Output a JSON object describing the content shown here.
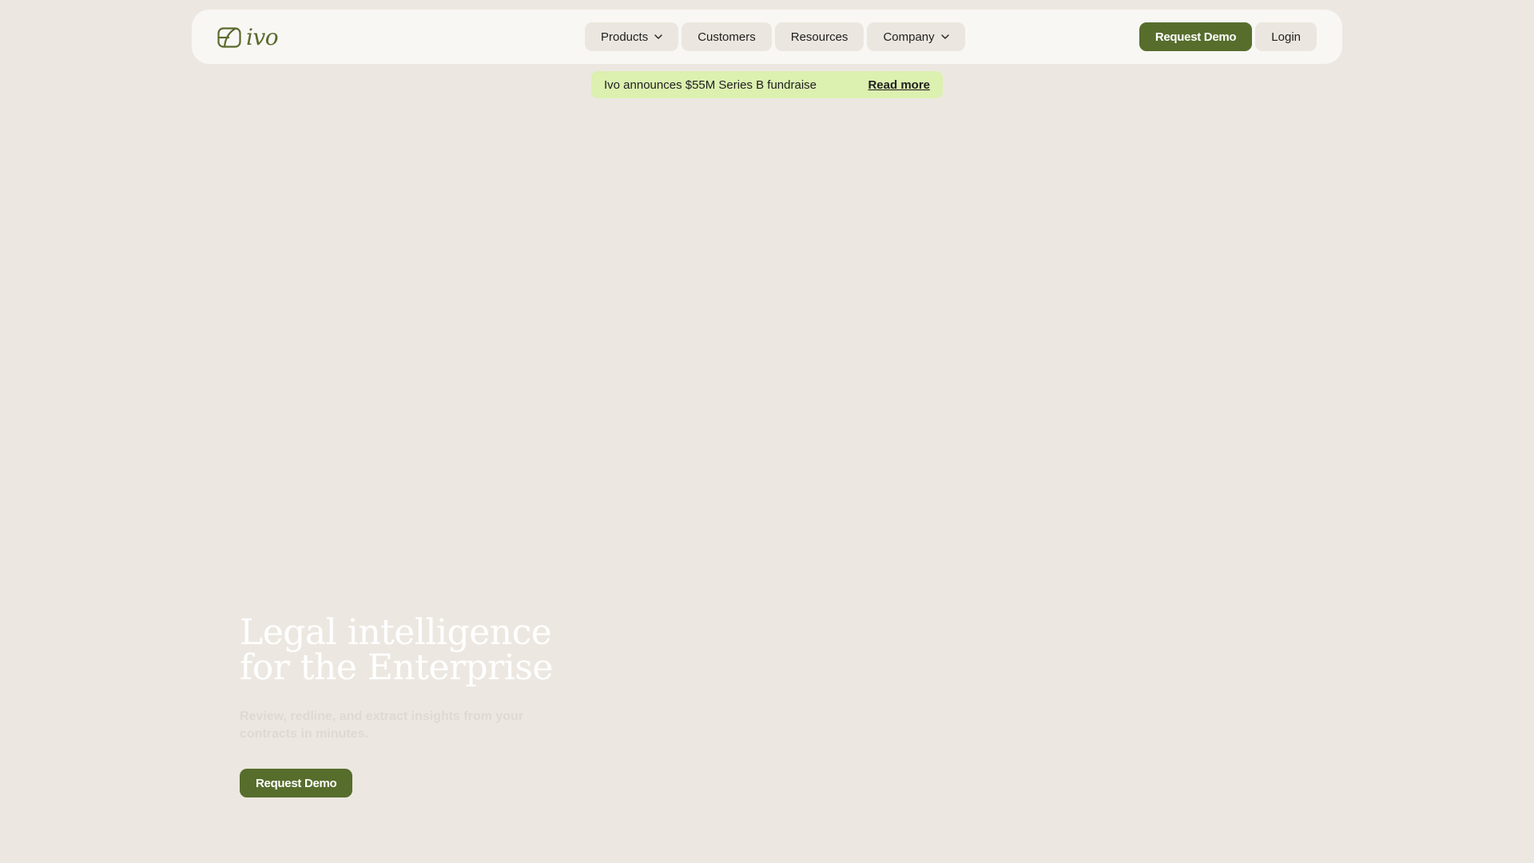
{
  "brand": {
    "logo_text": "ivo",
    "logo_icon": "ivo-mark-icon",
    "colors": {
      "primary": "#566d2c",
      "banner": "#dcf0b0",
      "background": "#ece8e1",
      "nav_background": "#f8f7f4",
      "pill": "#ebe7e0"
    }
  },
  "nav": {
    "items": [
      {
        "label": "Products",
        "has_dropdown": true,
        "icon": "chevron-down-icon"
      },
      {
        "label": "Customers",
        "has_dropdown": false
      },
      {
        "label": "Resources",
        "has_dropdown": false
      },
      {
        "label": "Company",
        "has_dropdown": true,
        "icon": "chevron-down-icon"
      }
    ],
    "request_demo_label": "Request Demo",
    "login_label": "Login"
  },
  "announcement": {
    "text": "Ivo announces $55M Series B fundraise",
    "link_label": "Read more"
  },
  "hero": {
    "title_line1": "Legal intelligence",
    "title_line2": "for the Enterprise",
    "subtitle": "Review, redline, and extract insights from your contracts in minutes.",
    "cta_label": "Request Demo"
  }
}
